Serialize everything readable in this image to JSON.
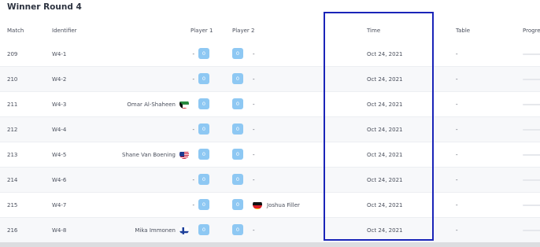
{
  "title": "Winner Round 4",
  "headers": {
    "match": "Match",
    "identifier": "Identifier",
    "player1": "Player 1",
    "player2": "Player 2",
    "time": "Time",
    "table": "Table",
    "progress": "Progre"
  },
  "rows": [
    {
      "match": "209",
      "identifier": "W4-1",
      "player1": "-",
      "score1": "0",
      "score2": "0",
      "player2": "-",
      "time": "Oct 24, 2021",
      "table": "-"
    },
    {
      "match": "210",
      "identifier": "W4-2",
      "player1": "-",
      "score1": "0",
      "score2": "0",
      "player2": "-",
      "time": "Oct 24, 2021",
      "table": "-"
    },
    {
      "match": "211",
      "identifier": "W4-3",
      "player1": "Omar Al-Shaheen",
      "player1_flag": "kuwait-flag-icon",
      "score1": "0",
      "score2": "0",
      "player2": "-",
      "time": "Oct 24, 2021",
      "table": "-"
    },
    {
      "match": "212",
      "identifier": "W4-4",
      "player1": "-",
      "score1": "0",
      "score2": "0",
      "player2": "-",
      "time": "Oct 24, 2021",
      "table": "-"
    },
    {
      "match": "213",
      "identifier": "W4-5",
      "player1": "Shane Van Boening",
      "player1_flag": "usa-flag-icon",
      "score1": "0",
      "score2": "0",
      "player2": "-",
      "time": "Oct 24, 2021",
      "table": "-"
    },
    {
      "match": "214",
      "identifier": "W4-6",
      "player1": "-",
      "score1": "0",
      "score2": "0",
      "player2": "-",
      "time": "Oct 24, 2021",
      "table": "-"
    },
    {
      "match": "215",
      "identifier": "W4-7",
      "player1": "-",
      "score1": "0",
      "score2": "0",
      "player2": "Joshua Filler",
      "player2_flag": "germany-flag-icon",
      "time": "Oct 24, 2021",
      "table": "-"
    },
    {
      "match": "216",
      "identifier": "W4-8",
      "player1": "Mika Immonen",
      "player1_flag": "finland-flag-icon",
      "score1": "0",
      "score2": "0",
      "player2": "-",
      "time": "Oct 24, 2021",
      "table": "-"
    }
  ],
  "colors": {
    "score_bg": "#8ec8f3",
    "highlight_border": "#1a24b8",
    "row_alt": "#f7f8fa"
  }
}
